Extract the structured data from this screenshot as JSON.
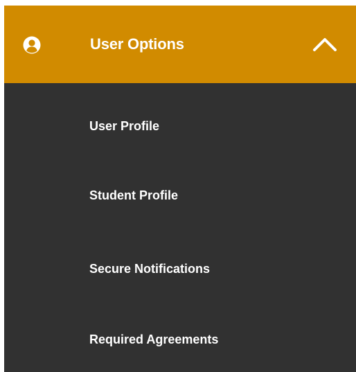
{
  "menu": {
    "header": {
      "title": "User Options",
      "icon": "user-circle-icon",
      "toggle_icon": "chevron-up-icon",
      "background": "#D18B00",
      "expanded": true
    },
    "background": "#313131",
    "text_color": "#FFFFFF",
    "items": [
      {
        "label": "User Profile"
      },
      {
        "label": "Student Profile"
      },
      {
        "label": "Secure Notifications"
      },
      {
        "label": "Required Agreements"
      }
    ]
  }
}
